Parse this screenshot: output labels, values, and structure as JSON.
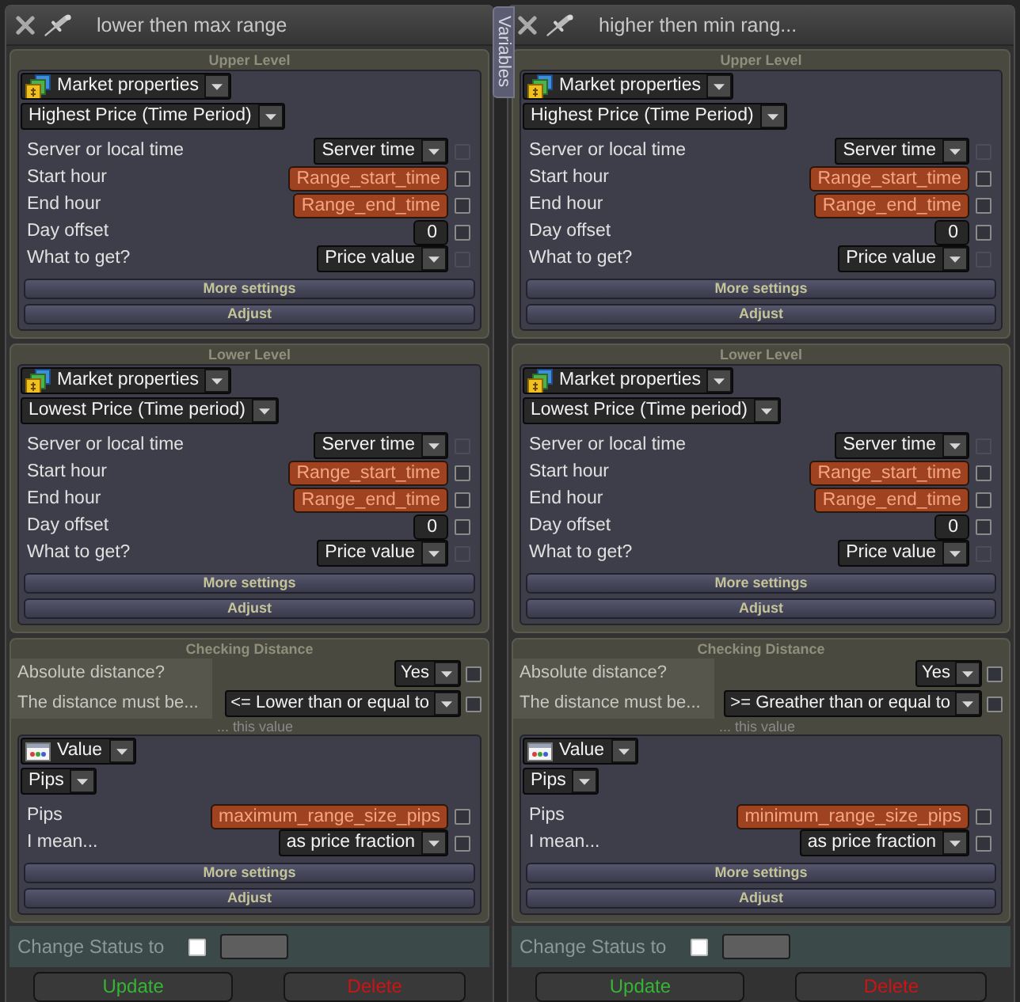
{
  "variables_tab": {
    "label": "Variables"
  },
  "panels": [
    {
      "title": "lower then max range",
      "levels": [
        {
          "header": "Upper Level",
          "source": {
            "kind": "market",
            "label": "Market properties"
          },
          "function": "Highest Price (Time Period)",
          "rows": [
            {
              "label": "Server or local time",
              "kind": "dropdown",
              "value": "Server time",
              "checkbox": {
                "checked": false,
                "disabled": true
              }
            },
            {
              "label": "Start hour",
              "kind": "variable",
              "value": "Range_start_time",
              "checkbox": {
                "checked": false,
                "disabled": false
              }
            },
            {
              "label": "End hour",
              "kind": "variable",
              "value": "Range_end_time",
              "checkbox": {
                "checked": false,
                "disabled": false
              }
            },
            {
              "label": "Day offset",
              "kind": "input",
              "value": "0",
              "checkbox": {
                "checked": false,
                "disabled": false
              }
            },
            {
              "label": "What to get?",
              "kind": "dropdown",
              "value": "Price value",
              "checkbox": {
                "checked": false,
                "disabled": true
              }
            }
          ],
          "buttons": [
            "More settings",
            "Adjust"
          ]
        },
        {
          "header": "Lower Level",
          "source": {
            "kind": "market",
            "label": "Market properties"
          },
          "function": "Lowest Price (Time period)",
          "rows": [
            {
              "label": "Server or local time",
              "kind": "dropdown",
              "value": "Server time",
              "checkbox": {
                "checked": false,
                "disabled": true
              }
            },
            {
              "label": "Start hour",
              "kind": "variable",
              "value": "Range_start_time",
              "checkbox": {
                "checked": false,
                "disabled": false
              }
            },
            {
              "label": "End hour",
              "kind": "variable",
              "value": "Range_end_time",
              "checkbox": {
                "checked": false,
                "disabled": false
              }
            },
            {
              "label": "Day offset",
              "kind": "input",
              "value": "0",
              "checkbox": {
                "checked": false,
                "disabled": false
              }
            },
            {
              "label": "What to get?",
              "kind": "dropdown",
              "value": "Price value",
              "checkbox": {
                "checked": false,
                "disabled": true
              }
            }
          ],
          "buttons": [
            "More settings",
            "Adjust"
          ]
        }
      ],
      "distance": {
        "header": "Checking Distance",
        "rows": [
          {
            "label": "Absolute distance?",
            "kind": "dropdown",
            "value": "Yes",
            "checkbox": {
              "checked": false,
              "disabled": false
            }
          },
          {
            "label": "The distance must be...",
            "kind": "dropdown",
            "value": "<= Lower than or equal to",
            "checkbox": {
              "checked": false,
              "disabled": false
            }
          }
        ],
        "note": "... this value",
        "operand": {
          "source": {
            "kind": "value",
            "label": "Value"
          },
          "function": "Pips",
          "rows": [
            {
              "label": "Pips",
              "kind": "variable",
              "value": "maximum_range_size_pips",
              "checkbox": {
                "checked": false,
                "disabled": false
              }
            },
            {
              "label": "I mean...",
              "kind": "dropdown",
              "value": "as price fraction",
              "checkbox": {
                "checked": false,
                "disabled": false
              }
            }
          ],
          "buttons": [
            "More settings",
            "Adjust"
          ]
        }
      },
      "status": {
        "label": "Change Status to",
        "checked": false
      },
      "actions": [
        {
          "label": "Update",
          "color": "#35b535"
        },
        {
          "label": "Delete",
          "color": "#cc1414"
        }
      ]
    },
    {
      "title": "higher then min rang...",
      "levels": [
        {
          "header": "Upper Level",
          "source": {
            "kind": "market",
            "label": "Market properties"
          },
          "function": "Highest Price (Time Period)",
          "rows": [
            {
              "label": "Server or local time",
              "kind": "dropdown",
              "value": "Server time",
              "checkbox": {
                "checked": false,
                "disabled": true
              }
            },
            {
              "label": "Start hour",
              "kind": "variable",
              "value": "Range_start_time",
              "checkbox": {
                "checked": false,
                "disabled": false
              }
            },
            {
              "label": "End hour",
              "kind": "variable",
              "value": "Range_end_time",
              "checkbox": {
                "checked": false,
                "disabled": false
              }
            },
            {
              "label": "Day offset",
              "kind": "input",
              "value": "0",
              "checkbox": {
                "checked": false,
                "disabled": false
              }
            },
            {
              "label": "What to get?",
              "kind": "dropdown",
              "value": "Price value",
              "checkbox": {
                "checked": false,
                "disabled": true
              }
            }
          ],
          "buttons": [
            "More settings",
            "Adjust"
          ]
        },
        {
          "header": "Lower Level",
          "source": {
            "kind": "market",
            "label": "Market properties"
          },
          "function": "Lowest Price (Time period)",
          "rows": [
            {
              "label": "Server or local time",
              "kind": "dropdown",
              "value": "Server time",
              "checkbox": {
                "checked": false,
                "disabled": true
              }
            },
            {
              "label": "Start hour",
              "kind": "variable",
              "value": "Range_start_time",
              "checkbox": {
                "checked": false,
                "disabled": false
              }
            },
            {
              "label": "End hour",
              "kind": "variable",
              "value": "Range_end_time",
              "checkbox": {
                "checked": false,
                "disabled": false
              }
            },
            {
              "label": "Day offset",
              "kind": "input",
              "value": "0",
              "checkbox": {
                "checked": false,
                "disabled": false
              }
            },
            {
              "label": "What to get?",
              "kind": "dropdown",
              "value": "Price value",
              "checkbox": {
                "checked": false,
                "disabled": true
              }
            }
          ],
          "buttons": [
            "More settings",
            "Adjust"
          ]
        }
      ],
      "distance": {
        "header": "Checking Distance",
        "rows": [
          {
            "label": "Absolute distance?",
            "kind": "dropdown",
            "value": "Yes",
            "checkbox": {
              "checked": false,
              "disabled": false
            }
          },
          {
            "label": "The distance must be...",
            "kind": "dropdown",
            "value": ">= Greather than or equal to",
            "checkbox": {
              "checked": false,
              "disabled": false
            }
          }
        ],
        "note": "... this value",
        "operand": {
          "source": {
            "kind": "value",
            "label": "Value"
          },
          "function": "Pips",
          "rows": [
            {
              "label": "Pips",
              "kind": "variable",
              "value": "minimum_range_size_pips",
              "checkbox": {
                "checked": false,
                "disabled": false
              }
            },
            {
              "label": "I mean...",
              "kind": "dropdown",
              "value": "as price fraction",
              "checkbox": {
                "checked": false,
                "disabled": false
              }
            }
          ],
          "buttons": [
            "More settings",
            "Adjust"
          ]
        }
      },
      "status": {
        "label": "Change Status to",
        "checked": false
      },
      "actions": [
        {
          "label": "Update",
          "color": "#35b535"
        },
        {
          "label": "Delete",
          "color": "#cc1414"
        }
      ]
    }
  ]
}
